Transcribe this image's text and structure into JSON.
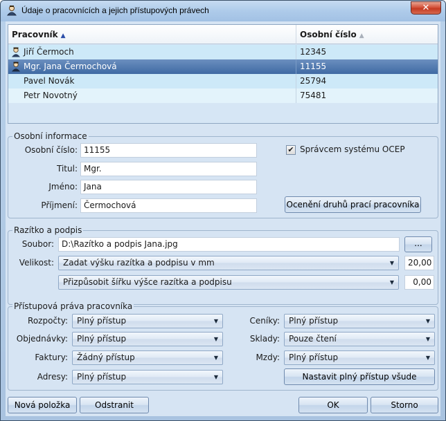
{
  "window": {
    "title": "Údaje o pracovnících a jejich přístupových právech",
    "close": "✕"
  },
  "list": {
    "columns": [
      "Pracovník",
      "Osobní číslo"
    ],
    "sort_icon": "▲",
    "rows": [
      {
        "name": "Jiří Čermoch",
        "number": "12345",
        "has_icon": true
      },
      {
        "name": "Mgr. Jana Čermochová",
        "number": "11155",
        "has_icon": true
      },
      {
        "name": "Pavel Novák",
        "number": "25794",
        "has_icon": false
      },
      {
        "name": "Petr Novotný",
        "number": "75481",
        "has_icon": false
      }
    ],
    "selected_row": 1
  },
  "personal": {
    "title": "Osobní informace",
    "labels": {
      "number": "Osobní číslo:",
      "degree": "Titul:",
      "first": "Jméno:",
      "last": "Příjmení:"
    },
    "values": {
      "number": "11155",
      "degree": "Mgr.",
      "first": "Jana",
      "last": "Čermochová"
    },
    "admin_checkbox": {
      "label": "Správcem systému OCEP",
      "checked": true,
      "mark": "✔"
    },
    "evaluate_button": "Ocenění druhů prací pracovníka"
  },
  "stamp": {
    "title": "Razítko a podpis",
    "file_label": "Soubor:",
    "file_value": "D:\\Razítko a podpis Jana.jpg",
    "browse_button": "...",
    "size_label": "Velikost:",
    "size_mode": "Zadat výšku razítka a podpisu v mm",
    "height_value": "20,00",
    "width_mode": "Přizpůsobit šířku výšce razítka a podpisu",
    "width_value": "0,00"
  },
  "rights": {
    "title": "Přístupová práva pracovníka",
    "left": [
      {
        "label": "Rozpočty:",
        "value": "Plný přístup"
      },
      {
        "label": "Objednávky:",
        "value": "Plný přístup"
      },
      {
        "label": "Faktury:",
        "value": "Žádný přístup"
      },
      {
        "label": "Adresy:",
        "value": "Plný přístup"
      }
    ],
    "right": [
      {
        "label": "Ceníky:",
        "value": "Plný přístup"
      },
      {
        "label": "Sklady:",
        "value": "Pouze čtení"
      },
      {
        "label": "Mzdy:",
        "value": "Plný přístup"
      }
    ],
    "full_access_button": "Nastavit plný přístup všude"
  },
  "footer": {
    "new": "Nová položka",
    "remove": "Odstranit",
    "ok": "OK",
    "cancel": "Storno"
  },
  "icons": {
    "window": "user-badge-icon",
    "person": "person-icon",
    "dropdown": "▼"
  },
  "colors": {
    "selection": "#3f6aa3",
    "titlebar": "#aecbea",
    "close": "#c43a22"
  }
}
